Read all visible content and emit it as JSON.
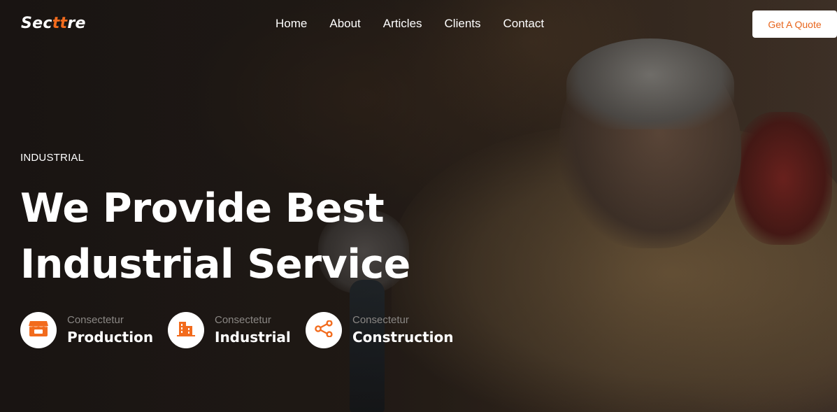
{
  "brand": {
    "logo_part1": "Sec",
    "logo_accent": "tt",
    "logo_part2": "re",
    "accent_color": "#f26b1d"
  },
  "nav": {
    "items": [
      {
        "label": "Home"
      },
      {
        "label": "About"
      },
      {
        "label": "Articles"
      },
      {
        "label": "Clients"
      },
      {
        "label": "Contact"
      }
    ]
  },
  "header": {
    "cta_label": "Get A Quote"
  },
  "hero": {
    "eyebrow": "INDUSTRIAL",
    "headline_line1": "We Provide Best",
    "headline_line2": "Industrial Service",
    "features": [
      {
        "icon": "storefront-icon",
        "kicker": "Consectetur",
        "title": "Production"
      },
      {
        "icon": "buildings-icon",
        "kicker": "Consectetur",
        "title": "Industrial"
      },
      {
        "icon": "share-nodes-icon",
        "kicker": "Consectetur",
        "title": "Construction"
      }
    ]
  },
  "colors": {
    "cta_text": "#e8651c",
    "icon_orange": "#f26b1d"
  }
}
